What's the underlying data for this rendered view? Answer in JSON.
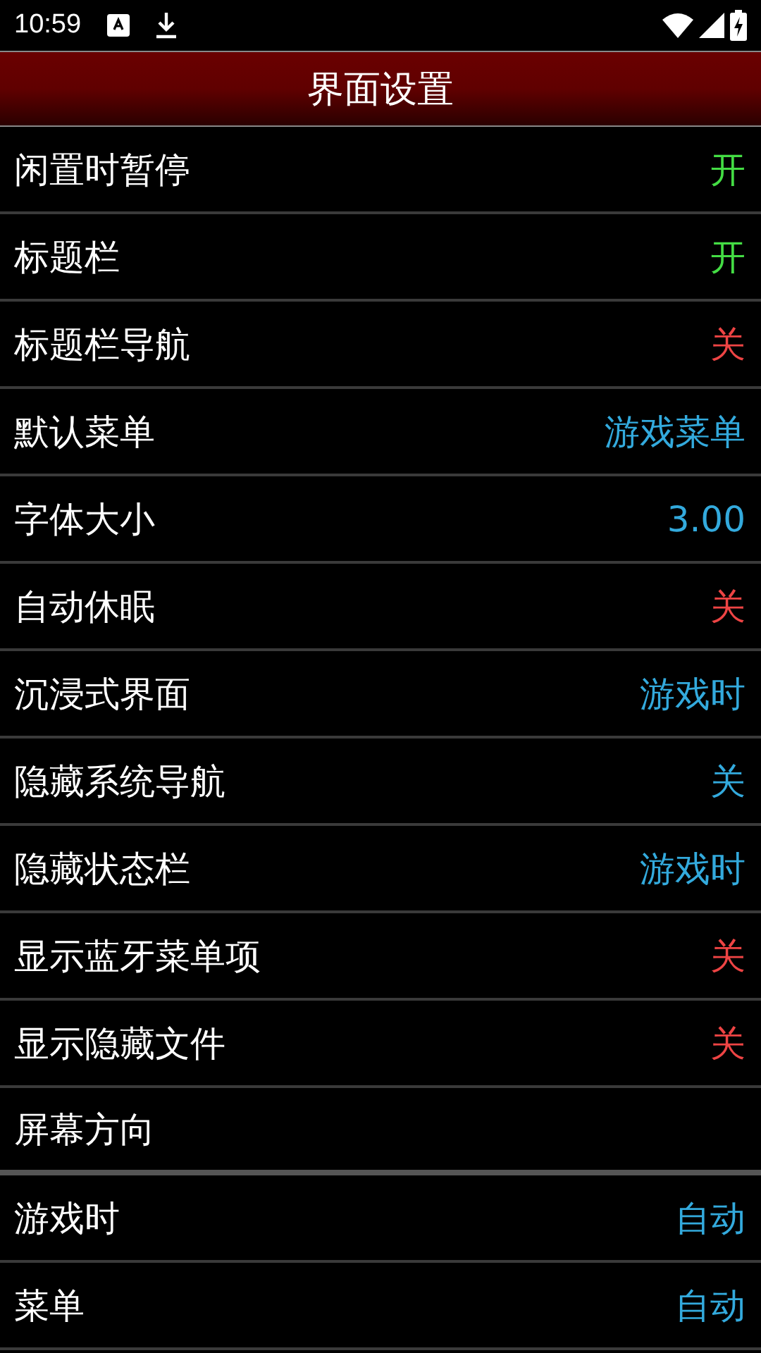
{
  "status_bar": {
    "time": "10:59"
  },
  "title": "界面设置",
  "rows": [
    {
      "kind": "setting",
      "label": "闲置时暂停",
      "value": "开",
      "color": "#44dd44"
    },
    {
      "kind": "setting",
      "label": "标题栏",
      "value": "开",
      "color": "#44dd44"
    },
    {
      "kind": "setting",
      "label": "标题栏导航",
      "value": "关",
      "color": "#ee4444"
    },
    {
      "kind": "setting",
      "label": "默认菜单",
      "value": "游戏菜单",
      "color": "#33aadd"
    },
    {
      "kind": "setting",
      "label": "字体大小",
      "value": "3.00",
      "color": "#33aadd"
    },
    {
      "kind": "setting",
      "label": "自动休眠",
      "value": "关",
      "color": "#ee4444"
    },
    {
      "kind": "setting",
      "label": "沉浸式界面",
      "value": "游戏时",
      "color": "#33aadd"
    },
    {
      "kind": "setting",
      "label": "隐藏系统导航",
      "value": "关",
      "color": "#33aadd"
    },
    {
      "kind": "setting",
      "label": "隐藏状态栏",
      "value": "游戏时",
      "color": "#33aadd"
    },
    {
      "kind": "setting",
      "label": "显示蓝牙菜单项",
      "value": "关",
      "color": "#ee4444"
    },
    {
      "kind": "setting",
      "label": "显示隐藏文件",
      "value": "关",
      "color": "#ee4444"
    },
    {
      "kind": "section",
      "label": "屏幕方向"
    },
    {
      "kind": "setting",
      "label": "游戏时",
      "value": "自动",
      "color": "#33aadd"
    },
    {
      "kind": "setting",
      "label": "菜单",
      "value": "自动",
      "color": "#33aadd"
    }
  ]
}
